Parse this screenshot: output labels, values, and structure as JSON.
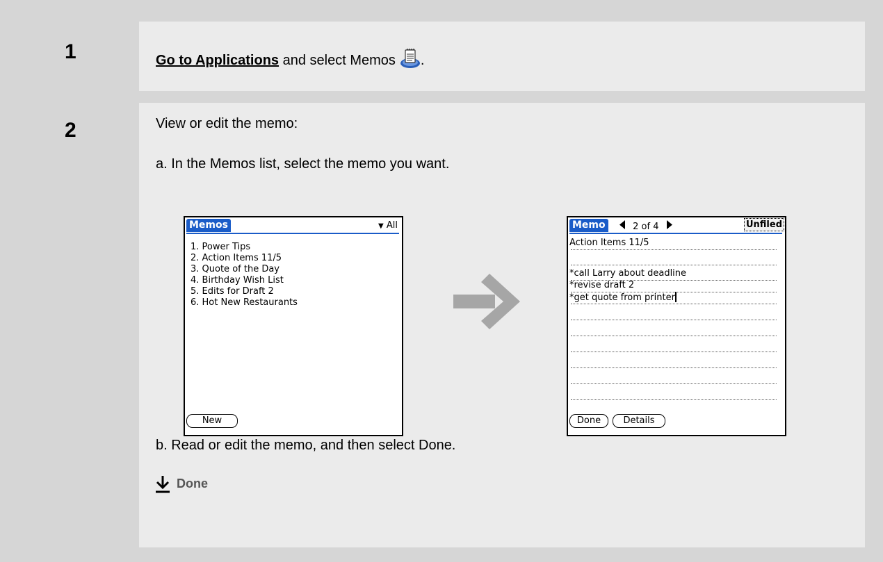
{
  "step1": {
    "number": "1",
    "link_text": "Go to Applications",
    "text_after": " and select Memos",
    "period": "."
  },
  "step2": {
    "number": "2",
    "intro": "View or edit the memo:",
    "sub_a": "a.  In the Memos list, select the memo you want.",
    "sub_b": "b.  Read or edit the memo, and then select Done.",
    "done_label": "Done"
  },
  "memos_list_screen": {
    "tab_title": "Memos",
    "category_arrow": "▼",
    "category": "All",
    "items": [
      "1. Power Tips",
      "2. Action Items 11/5",
      "3. Quote of the Day",
      "4. Birthday Wish List",
      "5. Edits for Draft 2",
      "6. Hot New Restaurants"
    ],
    "new_button": "New"
  },
  "memo_detail_screen": {
    "tab_title": "Memo",
    "page_indicator": "2 of 4",
    "category": "Unfiled",
    "lines": [
      "Action Items 11/5",
      "",
      "*call Larry about deadline",
      "*revise draft 2",
      "*get quote from printer"
    ],
    "done_button": "Done",
    "details_button": "Details"
  },
  "colors": {
    "palm_blue": "#1a5cc8",
    "frame_gray": "#d6d6d6",
    "panel_gray": "#ebebeb",
    "arrow_gray": "#a6a6a6"
  }
}
